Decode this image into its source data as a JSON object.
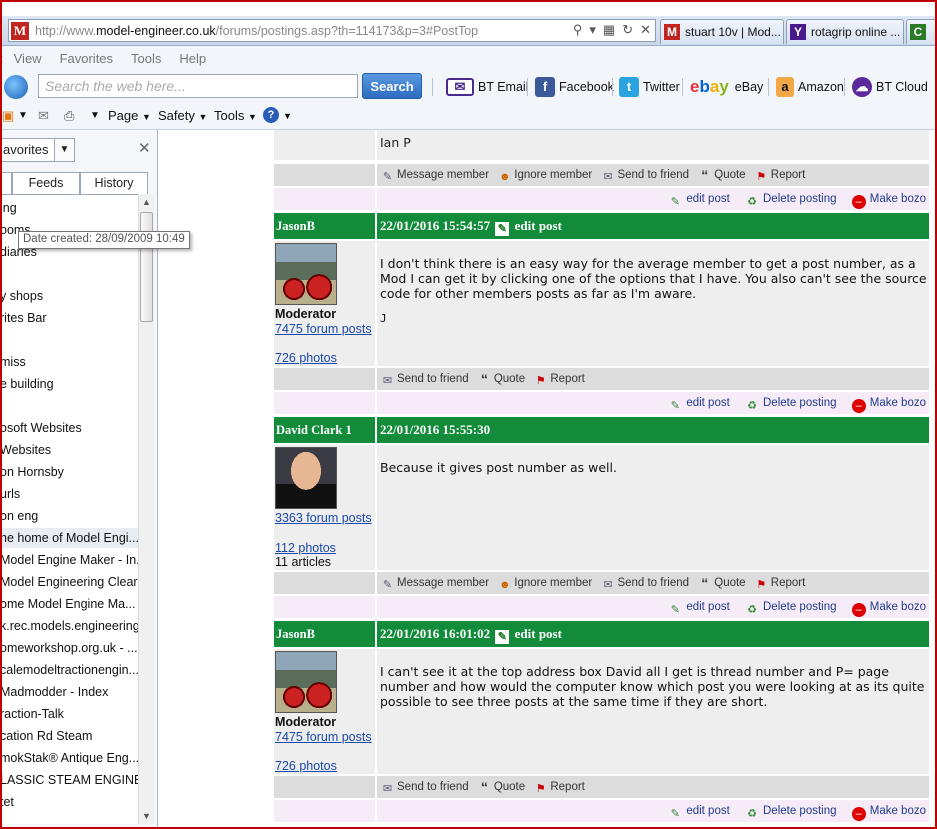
{
  "browser": {
    "url_prefix": "http://www.",
    "url_domain": "model-engineer.co.uk",
    "url_path": "/forums/postings.asp?th=114173&p=3#PostTop",
    "tabs": [
      {
        "label": "stuart 10v | Mod...",
        "icon": "model-engineer-icon",
        "color": "#c0261f"
      },
      {
        "label": "rotagrip online ...",
        "icon": "yahoo-icon",
        "color": "#4a1a8c"
      },
      {
        "label": "C",
        "icon": "page-icon",
        "color": "#2a7a2a"
      }
    ],
    "menu": [
      "View",
      "Favorites",
      "Tools",
      "Help"
    ],
    "search_placeholder": "Search the web here...",
    "search_button": "Search",
    "fav_links": [
      "BT Email",
      "Facebook",
      "Twitter",
      "eBay",
      "Amazon",
      "BT Cloud"
    ],
    "commands": [
      "Page",
      "Safety",
      "Tools"
    ]
  },
  "sidebar": {
    "dropdown_value": "avorites",
    "tabs": [
      "Feeds",
      "History"
    ],
    "tooltip": "Date created: 28/09/2009 10:49",
    "items": [
      "ing",
      "ooms",
      " diaries",
      "",
      "y shops",
      "rites Bar",
      "",
      "miss",
      "e building",
      "",
      "osoft Websites",
      " Websites",
      "on Hornsby",
      "urls",
      "on eng",
      "he home of Model Engi...",
      "Model Engine Maker - In...",
      "Model Engineering Clear...",
      "ome Model Engine Ma...",
      "k.rec.models.engineering",
      "omeworkshop.org.uk - ...",
      "calemodeltractionengin...",
      "Madmodder - Index",
      "raction-Talk",
      "cation Rd Steam",
      "mokStak® Antique Eng...",
      "LASSIC STEAM ENGINE...",
      "tet",
      ""
    ]
  },
  "forum": {
    "top_post_tail": "Ian P",
    "actions": {
      "message_member": "Message member",
      "ignore_member": "Ignore member",
      "send_to_friend": "Send to friend",
      "quote": "Quote",
      "report": "Report",
      "edit_post": "edit post",
      "delete_posting": "Delete posting",
      "make_bozo": "Make bozo"
    },
    "posts": [
      {
        "author": "JasonB",
        "datetime": "22/01/2016 15:54:57",
        "edit_label": "edit post",
        "role": "Moderator",
        "forum_posts": "7475 forum posts",
        "photos": "726 photos",
        "body": "I don't think there is an easy way for the average member to get a post number, as a Mod I can get it by clicking one of the options that I have. You also can't see the source code for other members posts as far as I'm aware.",
        "signature": "J"
      },
      {
        "author": "David Clark 1",
        "datetime": "22/01/2016 15:55:30",
        "forum_posts": "3363 forum posts",
        "photos": "112 photos",
        "articles": "11 articles",
        "body": "Because it gives post number as well."
      },
      {
        "author": "JasonB",
        "datetime": "22/01/2016 16:01:02",
        "edit_label": "edit post",
        "role": "Moderator",
        "forum_posts": "7475 forum posts",
        "photos": "726 photos",
        "body": "I can't see it at the top address box David all I get is thread number and P= page number and how would the computer know which post you were looking at as its quite possible to see three posts at the same time if they are short."
      }
    ]
  }
}
